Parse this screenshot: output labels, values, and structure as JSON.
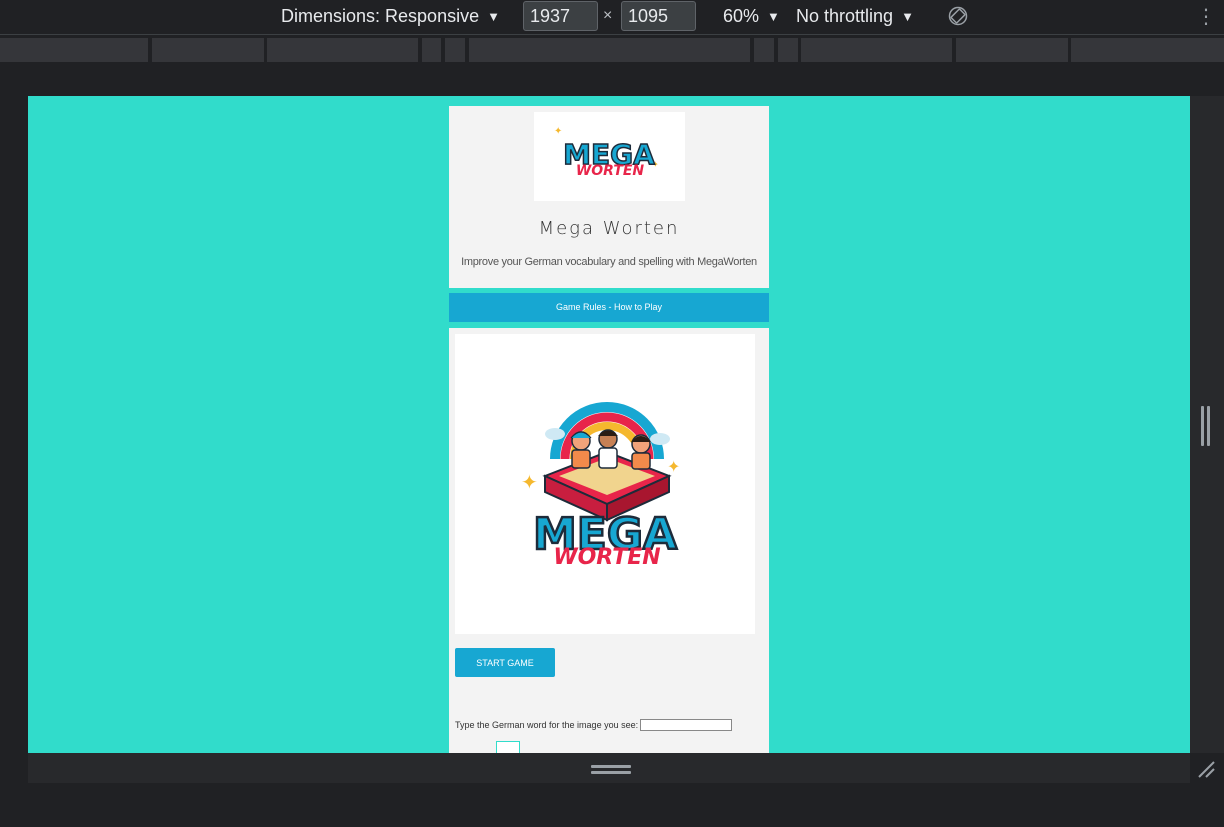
{
  "devtools": {
    "dimensions_label": "Dimensions: Responsive",
    "width_value": "1937",
    "height_value": "1095",
    "times_symbol": "×",
    "zoom_label": "60%",
    "throttling_label": "No throttling",
    "caret": "▼",
    "more_icon": "⋮"
  },
  "site": {
    "logo_text_top": "MEGA",
    "logo_text_bottom": "WORTEN",
    "title": "Mega Worten",
    "tagline": "Improve your German vocabulary and spelling with MegaWorten",
    "rules_button": "Game Rules - How to Play"
  },
  "game": {
    "hero_text_top": "MEGA",
    "hero_text_bottom": "WORTEN",
    "start_button": "START GAME",
    "prompt": "Type the German word for the image you see:"
  },
  "colors": {
    "viewport_bg": "#31dccb",
    "accent_blue": "#17a7d2",
    "logo_red": "#e8254a"
  }
}
